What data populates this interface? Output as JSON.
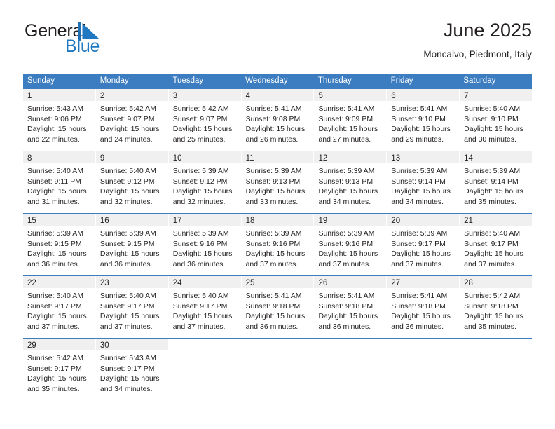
{
  "brand": {
    "name_top": "General",
    "name_bottom": "Blue",
    "mark": "triangle-flag-icon",
    "color_primary": "#1f78c1",
    "color_text": "#231f20"
  },
  "header": {
    "title": "June 2025",
    "subtitle": "Moncalvo, Piedmont, Italy"
  },
  "calendar": {
    "header_bg": "#3b7dc0",
    "row_rule": "#3b7dc0",
    "day_band_bg": "#f0f0f0",
    "weekdays": [
      "Sunday",
      "Monday",
      "Tuesday",
      "Wednesday",
      "Thursday",
      "Friday",
      "Saturday"
    ],
    "weeks": [
      [
        {
          "day": "1",
          "sunrise": "Sunrise: 5:43 AM",
          "sunset": "Sunset: 9:06 PM",
          "daylight1": "Daylight: 15 hours",
          "daylight2": "and 22 minutes."
        },
        {
          "day": "2",
          "sunrise": "Sunrise: 5:42 AM",
          "sunset": "Sunset: 9:07 PM",
          "daylight1": "Daylight: 15 hours",
          "daylight2": "and 24 minutes."
        },
        {
          "day": "3",
          "sunrise": "Sunrise: 5:42 AM",
          "sunset": "Sunset: 9:07 PM",
          "daylight1": "Daylight: 15 hours",
          "daylight2": "and 25 minutes."
        },
        {
          "day": "4",
          "sunrise": "Sunrise: 5:41 AM",
          "sunset": "Sunset: 9:08 PM",
          "daylight1": "Daylight: 15 hours",
          "daylight2": "and 26 minutes."
        },
        {
          "day": "5",
          "sunrise": "Sunrise: 5:41 AM",
          "sunset": "Sunset: 9:09 PM",
          "daylight1": "Daylight: 15 hours",
          "daylight2": "and 27 minutes."
        },
        {
          "day": "6",
          "sunrise": "Sunrise: 5:41 AM",
          "sunset": "Sunset: 9:10 PM",
          "daylight1": "Daylight: 15 hours",
          "daylight2": "and 29 minutes."
        },
        {
          "day": "7",
          "sunrise": "Sunrise: 5:40 AM",
          "sunset": "Sunset: 9:10 PM",
          "daylight1": "Daylight: 15 hours",
          "daylight2": "and 30 minutes."
        }
      ],
      [
        {
          "day": "8",
          "sunrise": "Sunrise: 5:40 AM",
          "sunset": "Sunset: 9:11 PM",
          "daylight1": "Daylight: 15 hours",
          "daylight2": "and 31 minutes."
        },
        {
          "day": "9",
          "sunrise": "Sunrise: 5:40 AM",
          "sunset": "Sunset: 9:12 PM",
          "daylight1": "Daylight: 15 hours",
          "daylight2": "and 32 minutes."
        },
        {
          "day": "10",
          "sunrise": "Sunrise: 5:39 AM",
          "sunset": "Sunset: 9:12 PM",
          "daylight1": "Daylight: 15 hours",
          "daylight2": "and 32 minutes."
        },
        {
          "day": "11",
          "sunrise": "Sunrise: 5:39 AM",
          "sunset": "Sunset: 9:13 PM",
          "daylight1": "Daylight: 15 hours",
          "daylight2": "and 33 minutes."
        },
        {
          "day": "12",
          "sunrise": "Sunrise: 5:39 AM",
          "sunset": "Sunset: 9:13 PM",
          "daylight1": "Daylight: 15 hours",
          "daylight2": "and 34 minutes."
        },
        {
          "day": "13",
          "sunrise": "Sunrise: 5:39 AM",
          "sunset": "Sunset: 9:14 PM",
          "daylight1": "Daylight: 15 hours",
          "daylight2": "and 34 minutes."
        },
        {
          "day": "14",
          "sunrise": "Sunrise: 5:39 AM",
          "sunset": "Sunset: 9:14 PM",
          "daylight1": "Daylight: 15 hours",
          "daylight2": "and 35 minutes."
        }
      ],
      [
        {
          "day": "15",
          "sunrise": "Sunrise: 5:39 AM",
          "sunset": "Sunset: 9:15 PM",
          "daylight1": "Daylight: 15 hours",
          "daylight2": "and 36 minutes."
        },
        {
          "day": "16",
          "sunrise": "Sunrise: 5:39 AM",
          "sunset": "Sunset: 9:15 PM",
          "daylight1": "Daylight: 15 hours",
          "daylight2": "and 36 minutes."
        },
        {
          "day": "17",
          "sunrise": "Sunrise: 5:39 AM",
          "sunset": "Sunset: 9:16 PM",
          "daylight1": "Daylight: 15 hours",
          "daylight2": "and 36 minutes."
        },
        {
          "day": "18",
          "sunrise": "Sunrise: 5:39 AM",
          "sunset": "Sunset: 9:16 PM",
          "daylight1": "Daylight: 15 hours",
          "daylight2": "and 37 minutes."
        },
        {
          "day": "19",
          "sunrise": "Sunrise: 5:39 AM",
          "sunset": "Sunset: 9:16 PM",
          "daylight1": "Daylight: 15 hours",
          "daylight2": "and 37 minutes."
        },
        {
          "day": "20",
          "sunrise": "Sunrise: 5:39 AM",
          "sunset": "Sunset: 9:17 PM",
          "daylight1": "Daylight: 15 hours",
          "daylight2": "and 37 minutes."
        },
        {
          "day": "21",
          "sunrise": "Sunrise: 5:40 AM",
          "sunset": "Sunset: 9:17 PM",
          "daylight1": "Daylight: 15 hours",
          "daylight2": "and 37 minutes."
        }
      ],
      [
        {
          "day": "22",
          "sunrise": "Sunrise: 5:40 AM",
          "sunset": "Sunset: 9:17 PM",
          "daylight1": "Daylight: 15 hours",
          "daylight2": "and 37 minutes."
        },
        {
          "day": "23",
          "sunrise": "Sunrise: 5:40 AM",
          "sunset": "Sunset: 9:17 PM",
          "daylight1": "Daylight: 15 hours",
          "daylight2": "and 37 minutes."
        },
        {
          "day": "24",
          "sunrise": "Sunrise: 5:40 AM",
          "sunset": "Sunset: 9:17 PM",
          "daylight1": "Daylight: 15 hours",
          "daylight2": "and 37 minutes."
        },
        {
          "day": "25",
          "sunrise": "Sunrise: 5:41 AM",
          "sunset": "Sunset: 9:18 PM",
          "daylight1": "Daylight: 15 hours",
          "daylight2": "and 36 minutes."
        },
        {
          "day": "26",
          "sunrise": "Sunrise: 5:41 AM",
          "sunset": "Sunset: 9:18 PM",
          "daylight1": "Daylight: 15 hours",
          "daylight2": "and 36 minutes."
        },
        {
          "day": "27",
          "sunrise": "Sunrise: 5:41 AM",
          "sunset": "Sunset: 9:18 PM",
          "daylight1": "Daylight: 15 hours",
          "daylight2": "and 36 minutes."
        },
        {
          "day": "28",
          "sunrise": "Sunrise: 5:42 AM",
          "sunset": "Sunset: 9:18 PM",
          "daylight1": "Daylight: 15 hours",
          "daylight2": "and 35 minutes."
        }
      ],
      [
        {
          "day": "29",
          "sunrise": "Sunrise: 5:42 AM",
          "sunset": "Sunset: 9:17 PM",
          "daylight1": "Daylight: 15 hours",
          "daylight2": "and 35 minutes."
        },
        {
          "day": "30",
          "sunrise": "Sunrise: 5:43 AM",
          "sunset": "Sunset: 9:17 PM",
          "daylight1": "Daylight: 15 hours",
          "daylight2": "and 34 minutes."
        },
        {
          "day": "",
          "sunrise": "",
          "sunset": "",
          "daylight1": "",
          "daylight2": ""
        },
        {
          "day": "",
          "sunrise": "",
          "sunset": "",
          "daylight1": "",
          "daylight2": ""
        },
        {
          "day": "",
          "sunrise": "",
          "sunset": "",
          "daylight1": "",
          "daylight2": ""
        },
        {
          "day": "",
          "sunrise": "",
          "sunset": "",
          "daylight1": "",
          "daylight2": ""
        },
        {
          "day": "",
          "sunrise": "",
          "sunset": "",
          "daylight1": "",
          "daylight2": ""
        }
      ]
    ]
  }
}
